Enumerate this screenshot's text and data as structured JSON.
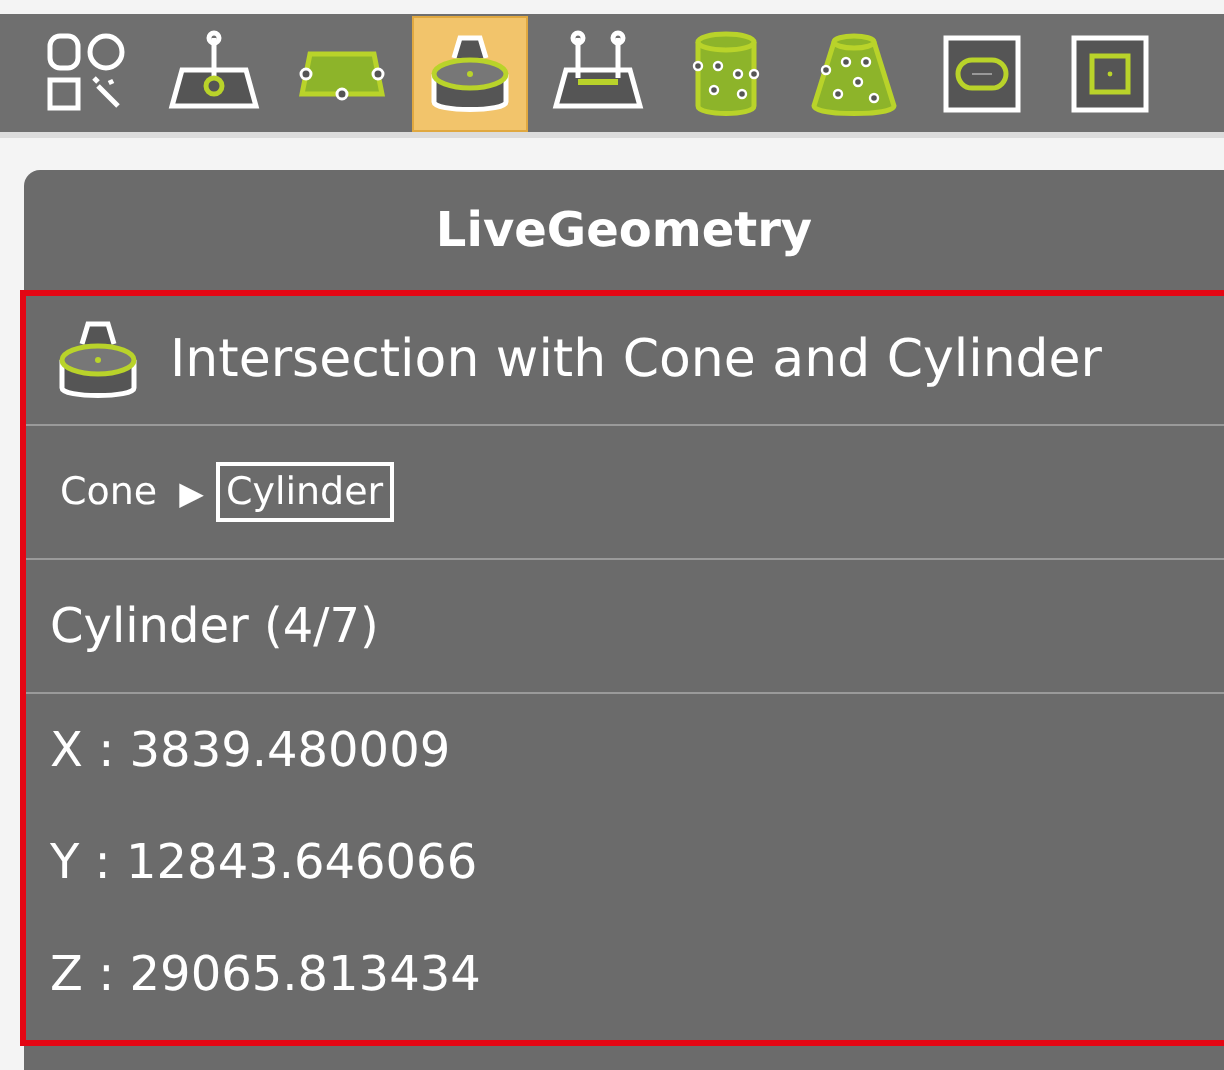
{
  "toolbar": {
    "tools": [
      {
        "kind": "shapes",
        "selected": false
      },
      {
        "kind": "plane-point",
        "selected": false
      },
      {
        "kind": "plane-edges",
        "selected": false
      },
      {
        "kind": "cone-cylinder",
        "selected": true
      },
      {
        "kind": "plane-slot",
        "selected": false
      },
      {
        "kind": "cylinder-points",
        "selected": false
      },
      {
        "kind": "cone-points",
        "selected": false
      },
      {
        "kind": "oval",
        "selected": false
      },
      {
        "kind": "square",
        "selected": false
      }
    ]
  },
  "panel": {
    "title": "LiveGeometry",
    "header": "Intersection with Cone and Cylinder",
    "breadcrumb": {
      "items": [
        {
          "label": "Cone",
          "selected": false
        },
        {
          "label": "Cylinder",
          "selected": true
        }
      ],
      "separator": "▶"
    },
    "section": "Cylinder (4/7)",
    "coordinates": [
      "X : 3839.480009",
      "Y : 12843.646066",
      "Z : 29065.813434"
    ]
  }
}
